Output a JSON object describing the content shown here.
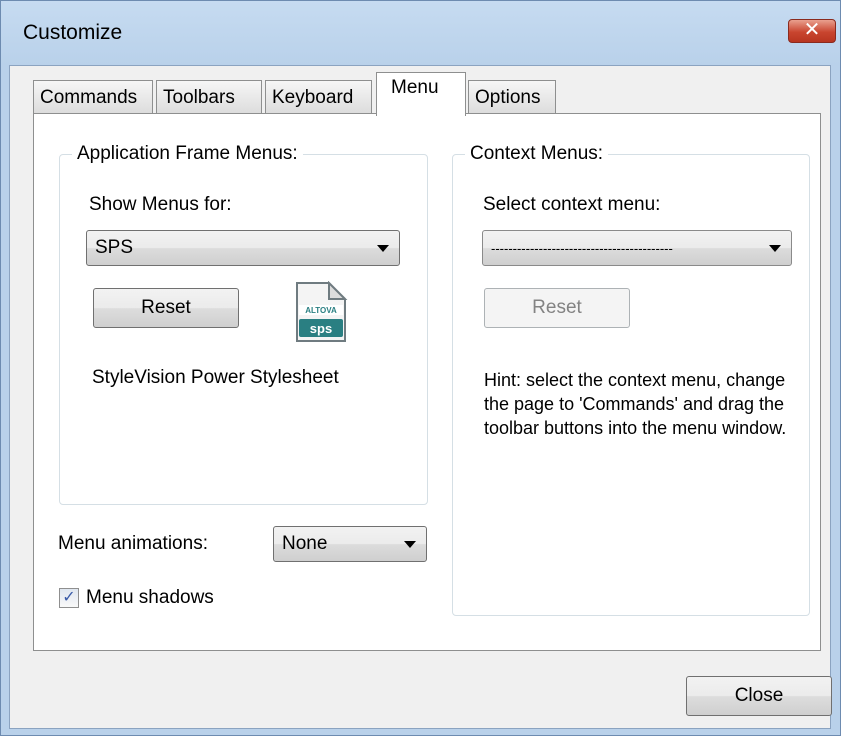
{
  "window": {
    "title": "Customize",
    "close_glyph": "✕"
  },
  "tabs": [
    {
      "label": "Commands",
      "active": false
    },
    {
      "label": "Toolbars",
      "active": false
    },
    {
      "label": "Keyboard",
      "active": false
    },
    {
      "label": "Menu",
      "active": true
    },
    {
      "label": "Options",
      "active": false
    }
  ],
  "app_frame": {
    "group_title": "Application Frame Menus:",
    "show_menus_label": "Show Menus for:",
    "show_menus_value": "SPS",
    "reset_label": "Reset",
    "icon_top_text": "ALTOVA",
    "icon_bottom_text": "sps",
    "doc_type": "StyleVision Power Stylesheet"
  },
  "context": {
    "group_title": "Context Menus:",
    "select_label": "Select context menu:",
    "select_value": "------------------------------------------",
    "reset_label": "Reset",
    "hint": "Hint: select the context menu, change the page to 'Commands' and drag the toolbar buttons into the menu window."
  },
  "animations": {
    "label": "Menu animations:",
    "value": "None"
  },
  "shadows": {
    "label": "Menu shadows",
    "checked": true,
    "check_glyph": "✓"
  },
  "footer": {
    "close_label": "Close"
  },
  "colors": {
    "title_bar": "#b9d1ea",
    "close_button": "#c9452f",
    "icon_teal": "#2a7f82"
  }
}
